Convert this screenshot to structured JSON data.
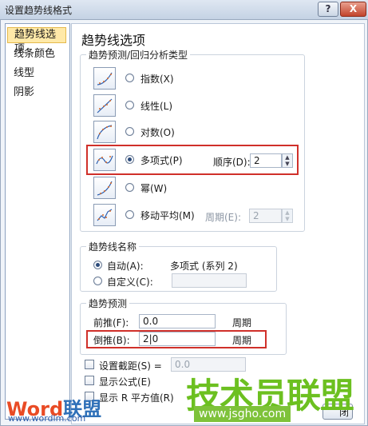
{
  "window": {
    "title": "设置趋势线格式",
    "help_label": "?",
    "close_label": "X"
  },
  "sidebar": {
    "items": [
      {
        "label": "趋势线选项"
      },
      {
        "label": "线条颜色"
      },
      {
        "label": "线型"
      },
      {
        "label": "阴影"
      }
    ]
  },
  "main": {
    "heading": "趋势线选项",
    "type_group": {
      "legend": "趋势预测/回归分析类型",
      "options": [
        {
          "label": "指数(X)",
          "icon": "exponential-trend-icon",
          "selected": false
        },
        {
          "label": "线性(L)",
          "icon": "linear-trend-icon",
          "selected": false
        },
        {
          "label": "对数(O)",
          "icon": "logarithmic-trend-icon",
          "selected": false
        },
        {
          "label": "多项式(P)",
          "icon": "polynomial-trend-icon",
          "selected": true
        },
        {
          "label": "幂(W)",
          "icon": "power-trend-icon",
          "selected": false
        },
        {
          "label": "移动平均(M)",
          "icon": "moving-average-icon",
          "selected": false
        }
      ],
      "order_label": "顺序(D):",
      "order_value": "2",
      "period_label": "周期(E):",
      "period_value": "2"
    },
    "name_group": {
      "legend": "趋势线名称",
      "auto_label": "自动(A):",
      "auto_value": "多项式 (系列 2)",
      "custom_label": "自定义(C):",
      "custom_value": ""
    },
    "forecast_group": {
      "legend": "趋势预测",
      "forward_label": "前推(F):",
      "forward_value": "0.0",
      "forward_unit": "周期",
      "backward_label": "倒推(B):",
      "backward_value": "2|0",
      "backward_unit": "周期"
    },
    "intercept_label": "设置截距(S) =",
    "intercept_value": "0.0",
    "show_equation_label": "显示公式(E)",
    "show_r2_label": "显示 R 平方值(R)",
    "close_button_label": "闭"
  },
  "watermarks": {
    "left_logo_a": "Word",
    "left_logo_b": "联盟",
    "left_url": "www.wordlm.com",
    "right_logo": "技术员联盟",
    "right_url": "www.jsgho.com"
  }
}
